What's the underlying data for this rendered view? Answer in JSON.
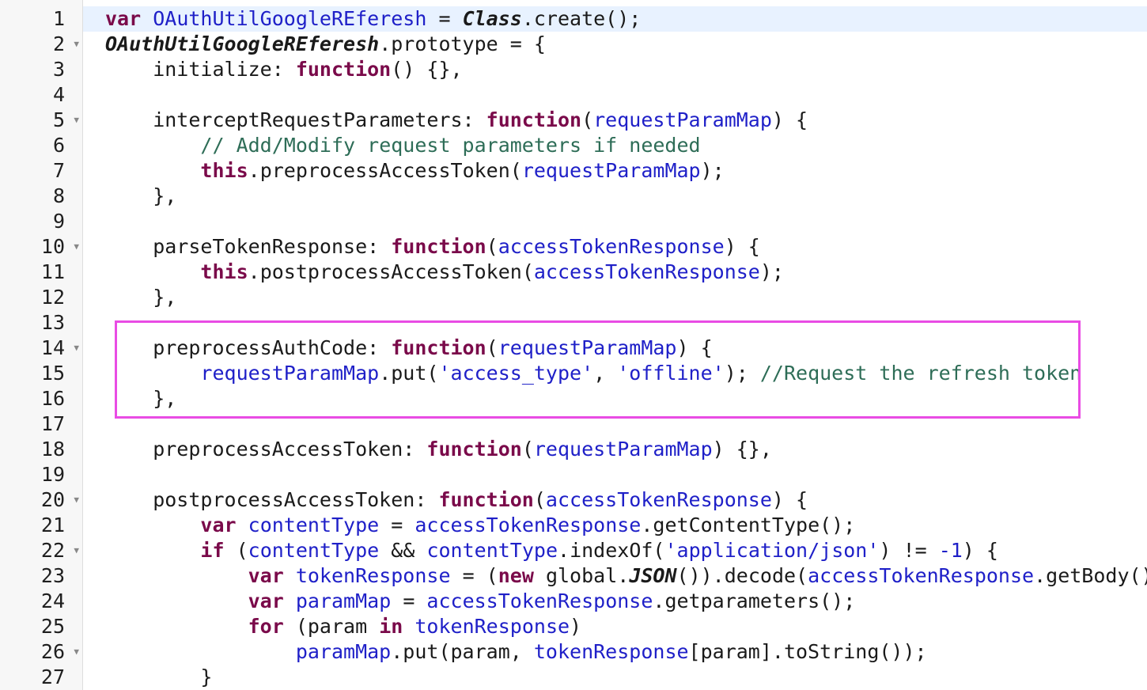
{
  "editor": {
    "accent_highlight_color": "#e94ce4",
    "active_line_color": "#e8f2ff",
    "lines": [
      {
        "num": "1",
        "fold": false,
        "active": true,
        "tokens": [
          {
            "t": "var",
            "c": "kw"
          },
          {
            "t": " "
          },
          {
            "t": "OAuthUtilGoogleREferesh",
            "c": "var"
          },
          {
            "t": " = "
          },
          {
            "t": "Class",
            "c": "cls"
          },
          {
            "t": ".create();"
          }
        ]
      },
      {
        "num": "2",
        "fold": true,
        "tokens": [
          {
            "t": "OAuthUtilGoogleREferesh",
            "c": "cls"
          },
          {
            "t": ".prototype = {"
          }
        ]
      },
      {
        "num": "3",
        "fold": false,
        "tokens": [
          {
            "t": "    initialize: "
          },
          {
            "t": "function",
            "c": "kw"
          },
          {
            "t": "() {},"
          }
        ]
      },
      {
        "num": "4",
        "fold": false,
        "tokens": []
      },
      {
        "num": "5",
        "fold": true,
        "tokens": [
          {
            "t": "    interceptRequestParameters: "
          },
          {
            "t": "function",
            "c": "kw"
          },
          {
            "t": "("
          },
          {
            "t": "requestParamMap",
            "c": "var"
          },
          {
            "t": ") {"
          }
        ]
      },
      {
        "num": "6",
        "fold": false,
        "tokens": [
          {
            "t": "        "
          },
          {
            "t": "// Add/Modify request parameters if needed",
            "c": "com"
          }
        ]
      },
      {
        "num": "7",
        "fold": false,
        "tokens": [
          {
            "t": "        "
          },
          {
            "t": "this",
            "c": "kw"
          },
          {
            "t": ".preprocessAccessToken("
          },
          {
            "t": "requestParamMap",
            "c": "var"
          },
          {
            "t": ");"
          }
        ]
      },
      {
        "num": "8",
        "fold": false,
        "tokens": [
          {
            "t": "    },"
          }
        ]
      },
      {
        "num": "9",
        "fold": false,
        "tokens": []
      },
      {
        "num": "10",
        "fold": true,
        "tokens": [
          {
            "t": "    parseTokenResponse: "
          },
          {
            "t": "function",
            "c": "kw"
          },
          {
            "t": "("
          },
          {
            "t": "accessTokenResponse",
            "c": "var"
          },
          {
            "t": ") {"
          }
        ]
      },
      {
        "num": "11",
        "fold": false,
        "tokens": [
          {
            "t": "        "
          },
          {
            "t": "this",
            "c": "kw"
          },
          {
            "t": ".postprocessAccessToken("
          },
          {
            "t": "accessTokenResponse",
            "c": "var"
          },
          {
            "t": ");"
          }
        ]
      },
      {
        "num": "12",
        "fold": false,
        "tokens": [
          {
            "t": "    },"
          }
        ]
      },
      {
        "num": "13",
        "fold": false,
        "tokens": []
      },
      {
        "num": "14",
        "fold": true,
        "tokens": [
          {
            "t": "    preprocessAuthCode: "
          },
          {
            "t": "function",
            "c": "kw"
          },
          {
            "t": "("
          },
          {
            "t": "requestParamMap",
            "c": "var"
          },
          {
            "t": ") {"
          }
        ]
      },
      {
        "num": "15",
        "fold": false,
        "tokens": [
          {
            "t": "        "
          },
          {
            "t": "requestParamMap",
            "c": "var"
          },
          {
            "t": ".put("
          },
          {
            "t": "'access_type'",
            "c": "str"
          },
          {
            "t": ", "
          },
          {
            "t": "'offline'",
            "c": "str"
          },
          {
            "t": "); "
          },
          {
            "t": "//Request the refresh token",
            "c": "com"
          }
        ]
      },
      {
        "num": "16",
        "fold": false,
        "tokens": [
          {
            "t": "    },"
          }
        ]
      },
      {
        "num": "17",
        "fold": false,
        "tokens": []
      },
      {
        "num": "18",
        "fold": false,
        "tokens": [
          {
            "t": "    preprocessAccessToken: "
          },
          {
            "t": "function",
            "c": "kw"
          },
          {
            "t": "("
          },
          {
            "t": "requestParamMap",
            "c": "var"
          },
          {
            "t": ") {},"
          }
        ]
      },
      {
        "num": "19",
        "fold": false,
        "tokens": []
      },
      {
        "num": "20",
        "fold": true,
        "tokens": [
          {
            "t": "    postprocessAccessToken: "
          },
          {
            "t": "function",
            "c": "kw"
          },
          {
            "t": "("
          },
          {
            "t": "accessTokenResponse",
            "c": "var"
          },
          {
            "t": ") {"
          }
        ]
      },
      {
        "num": "21",
        "fold": false,
        "tokens": [
          {
            "t": "        "
          },
          {
            "t": "var",
            "c": "kw"
          },
          {
            "t": " "
          },
          {
            "t": "contentType",
            "c": "var"
          },
          {
            "t": " = "
          },
          {
            "t": "accessTokenResponse",
            "c": "var"
          },
          {
            "t": ".getContentType();"
          }
        ]
      },
      {
        "num": "22",
        "fold": true,
        "tokens": [
          {
            "t": "        "
          },
          {
            "t": "if",
            "c": "kw"
          },
          {
            "t": " ("
          },
          {
            "t": "contentType",
            "c": "var"
          },
          {
            "t": " && "
          },
          {
            "t": "contentType",
            "c": "var"
          },
          {
            "t": ".indexOf("
          },
          {
            "t": "'application/json'",
            "c": "str"
          },
          {
            "t": ") != "
          },
          {
            "t": "-1",
            "c": "num"
          },
          {
            "t": ") {"
          }
        ]
      },
      {
        "num": "23",
        "fold": false,
        "tokens": [
          {
            "t": "            "
          },
          {
            "t": "var",
            "c": "kw"
          },
          {
            "t": " "
          },
          {
            "t": "tokenResponse",
            "c": "var"
          },
          {
            "t": " = ("
          },
          {
            "t": "new",
            "c": "kw"
          },
          {
            "t": " global."
          },
          {
            "t": "JSON",
            "c": "cls"
          },
          {
            "t": "()).decode("
          },
          {
            "t": "accessTokenResponse",
            "c": "var"
          },
          {
            "t": ".getBody());"
          }
        ]
      },
      {
        "num": "24",
        "fold": false,
        "tokens": [
          {
            "t": "            "
          },
          {
            "t": "var",
            "c": "kw"
          },
          {
            "t": " "
          },
          {
            "t": "paramMap",
            "c": "var"
          },
          {
            "t": " = "
          },
          {
            "t": "accessTokenResponse",
            "c": "var"
          },
          {
            "t": ".getparameters();"
          }
        ]
      },
      {
        "num": "25",
        "fold": false,
        "tokens": [
          {
            "t": "            "
          },
          {
            "t": "for",
            "c": "kw"
          },
          {
            "t": " (param "
          },
          {
            "t": "in",
            "c": "kw"
          },
          {
            "t": " "
          },
          {
            "t": "tokenResponse",
            "c": "var"
          },
          {
            "t": ")"
          }
        ]
      },
      {
        "num": "26",
        "fold": true,
        "tokens": [
          {
            "t": "                "
          },
          {
            "t": "paramMap",
            "c": "var"
          },
          {
            "t": ".put(param, "
          },
          {
            "t": "tokenResponse",
            "c": "var"
          },
          {
            "t": "[param].toString());"
          }
        ]
      },
      {
        "num": "27",
        "fold": false,
        "tokens": [
          {
            "t": "        }"
          }
        ]
      }
    ]
  }
}
